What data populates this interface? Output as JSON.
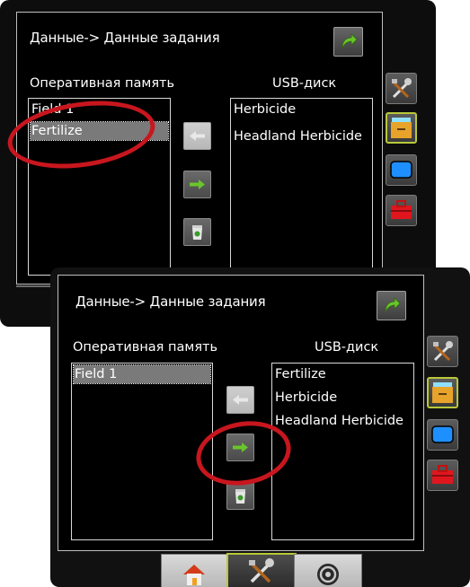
{
  "screenshot_top": {
    "title": "Данные-> Данные задания",
    "left_list_caption": "Оперативная память",
    "right_list_caption": "USB-диск",
    "left_list": [
      "Field 1",
      "Fertilize"
    ],
    "left_selected_index": 1,
    "right_list": [
      "Herbicide",
      "Headland Herbicide"
    ],
    "buttons": [
      {
        "icon": "arrow-left-icon",
        "enabled": false
      },
      {
        "icon": "arrow-right-icon",
        "enabled": true
      },
      {
        "icon": "recycle-bin-icon",
        "enabled": true
      }
    ],
    "side_tabs": [
      "tools-icon",
      "file-cabinet-icon",
      "monitor-icon",
      "toolbox-icon"
    ],
    "active_side_tab": "file-cabinet-icon",
    "highlighted_item": "Fertilize"
  },
  "screenshot_bottom": {
    "title": "Данные-> Данные задания",
    "left_list_caption": "Оперативная память",
    "right_list_caption": "USB-диск",
    "left_list": [
      "Field 1"
    ],
    "left_selected_index": 0,
    "right_list": [
      "Fertilize",
      "Herbicide",
      "Headland Herbicide"
    ],
    "buttons": [
      {
        "icon": "arrow-left-icon",
        "enabled": false
      },
      {
        "icon": "arrow-right-icon",
        "enabled": true
      },
      {
        "icon": "recycle-bin-icon",
        "enabled": true
      }
    ],
    "side_tabs": [
      "tools-icon",
      "file-cabinet-icon",
      "monitor-icon",
      "toolbox-icon"
    ],
    "active_side_tab": "file-cabinet-icon",
    "bottom_tabs": [
      "home-icon",
      "tools-icon",
      "gauge-icon"
    ],
    "active_bottom_tab": "tools-icon",
    "highlighted_control": "arrow-right-icon"
  },
  "colors": {
    "background": "#000000",
    "active_tab_border": "#b8c83a",
    "arrow_green": "#6ac52a",
    "highlight_red": "#c8161e"
  }
}
